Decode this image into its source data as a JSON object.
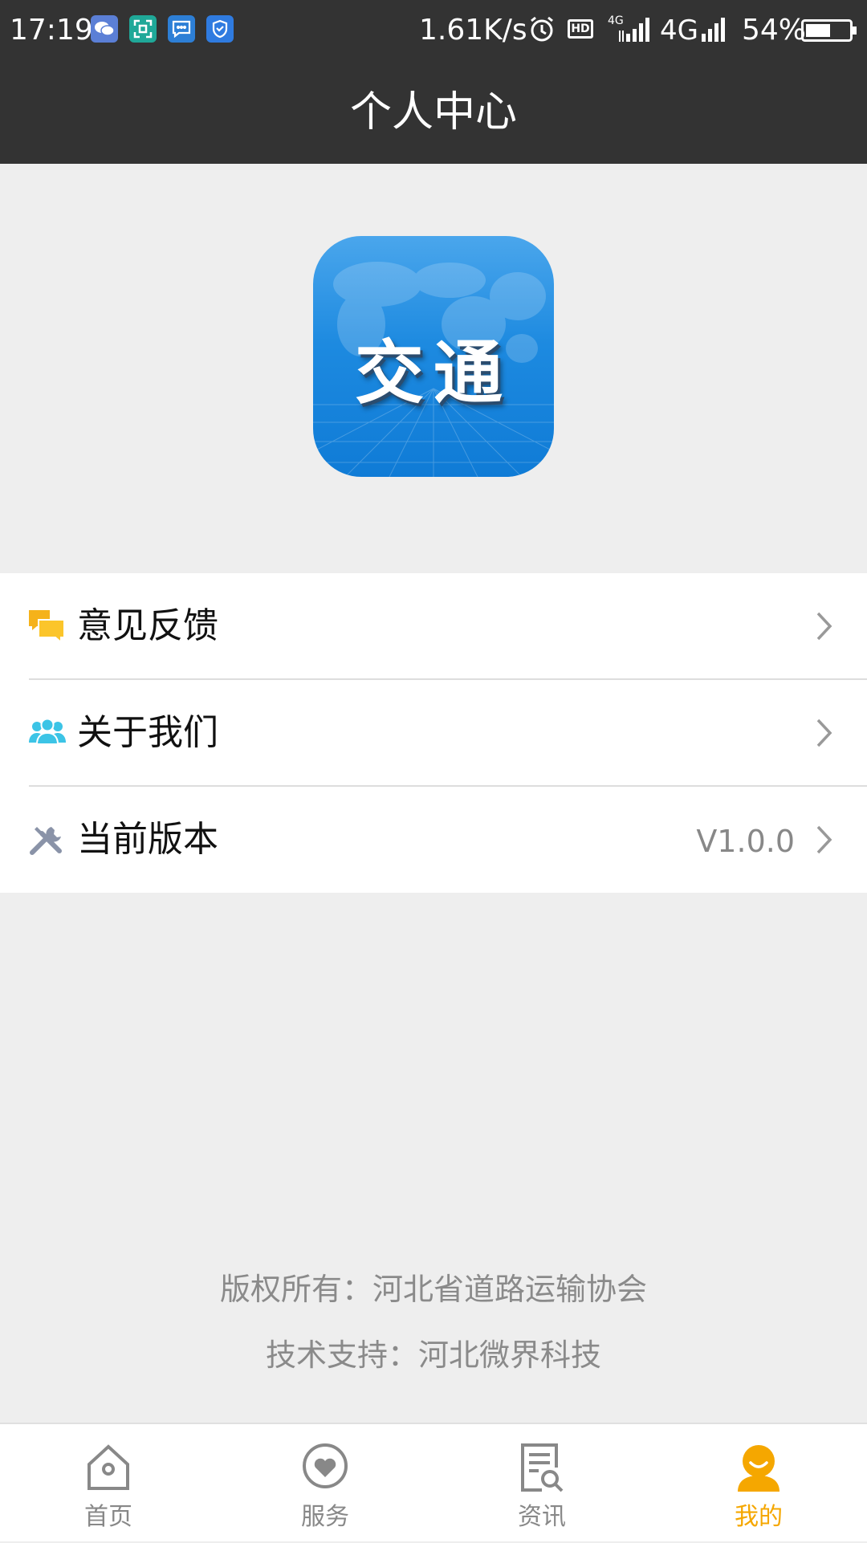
{
  "status_bar": {
    "time": "17:19",
    "net_speed": "1.61K/s",
    "hd_label": "HD",
    "small_network": "4G",
    "network": "4G",
    "battery": "54%",
    "icons": [
      "wechat-icon",
      "scan-icon",
      "message-icon",
      "shield-icon",
      "alarm-icon",
      "signal-icon",
      "battery-icon"
    ]
  },
  "header": {
    "title": "个人中心"
  },
  "logo": {
    "text": "交通"
  },
  "menu": {
    "items": [
      {
        "label": "意见反馈",
        "icon": "feedback-icon",
        "value": ""
      },
      {
        "label": "关于我们",
        "icon": "users-icon",
        "value": ""
      },
      {
        "label": "当前版本",
        "icon": "tools-icon",
        "value": "V1.0.0"
      }
    ]
  },
  "footer": {
    "copyright": "版权所有：河北省道路运输协会",
    "support": "技术支持：河北微界科技"
  },
  "bottom_nav": {
    "items": [
      {
        "label": "首页",
        "icon": "home-icon"
      },
      {
        "label": "服务",
        "icon": "service-icon"
      },
      {
        "label": "资讯",
        "icon": "news-icon"
      },
      {
        "label": "我的",
        "icon": "profile-icon",
        "active": true
      }
    ]
  },
  "colors": {
    "header_bg": "#333333",
    "page_bg": "#eeeeee",
    "active_nav": "#f5a700",
    "feedback_icon": "#f5b21a",
    "users_icon": "#3cc4e6",
    "tools_icon": "#8a93a8"
  }
}
